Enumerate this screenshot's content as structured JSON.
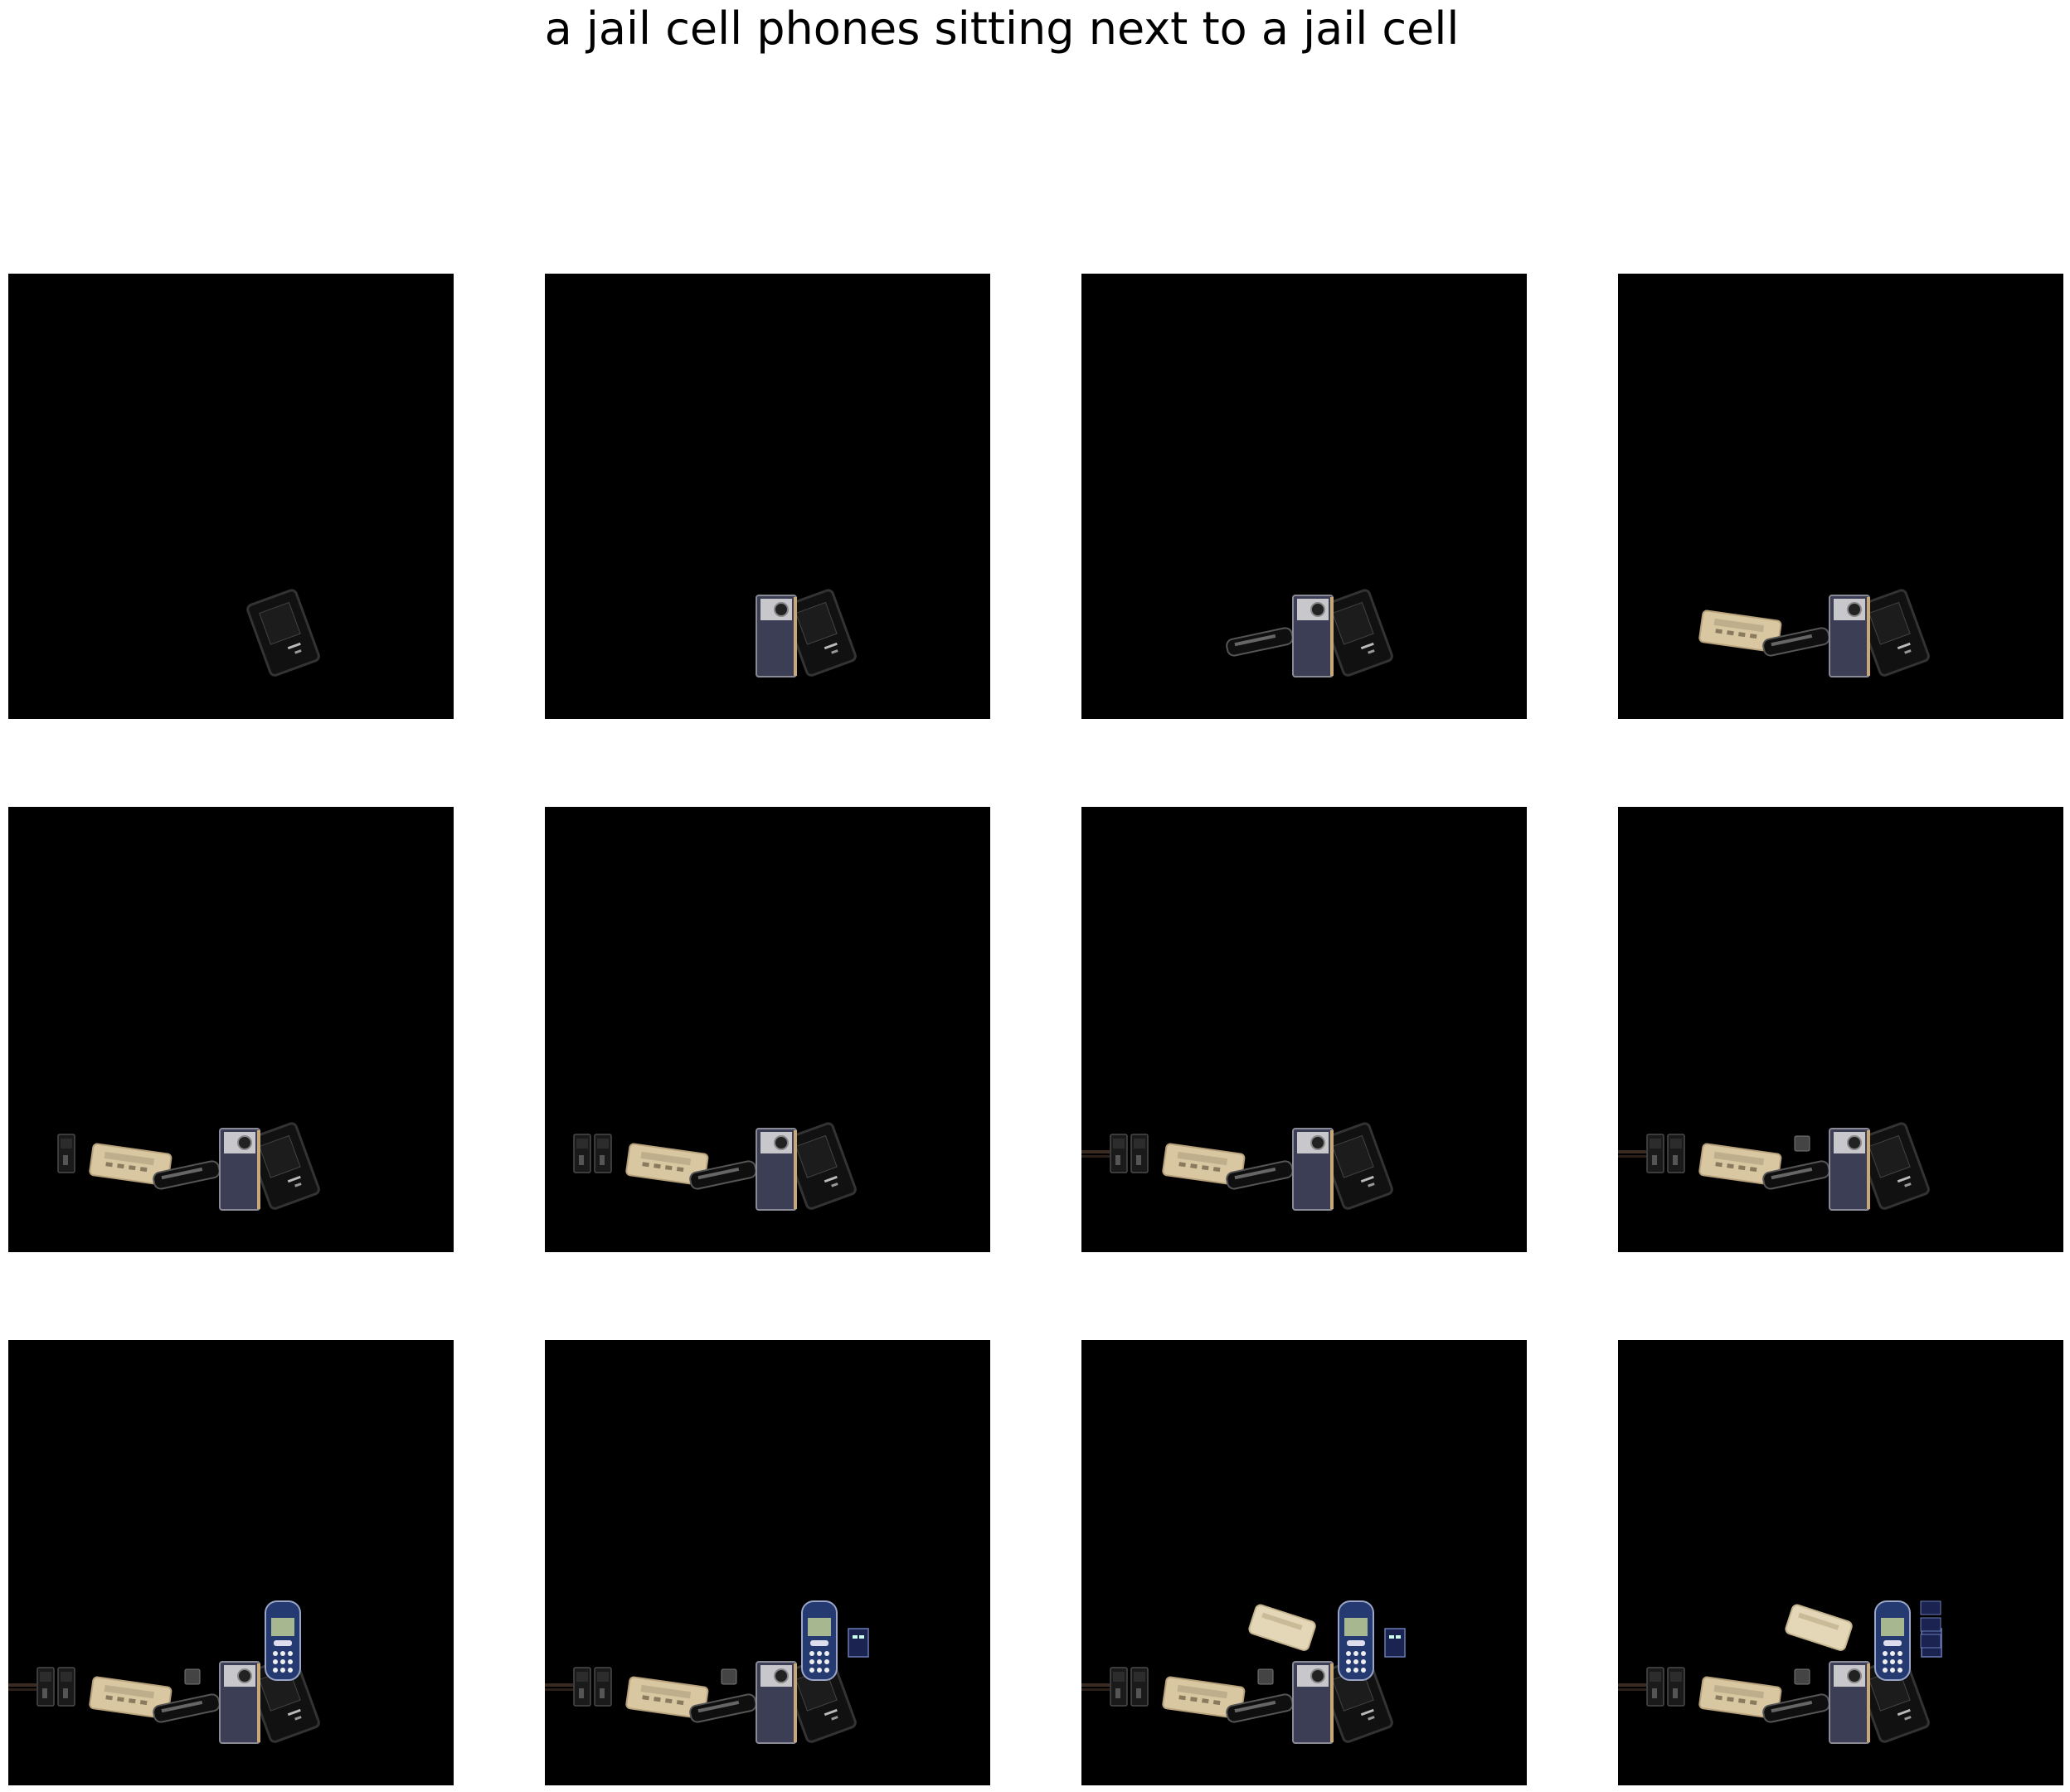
{
  "title": "a jail cell phones sitting next to a jail cell",
  "panels": [
    {
      "id": 1,
      "objects": [
        "black-flip-phone"
      ]
    },
    {
      "id": 2,
      "objects": [
        "black-flip-phone",
        "silver-phone"
      ]
    },
    {
      "id": 3,
      "objects": [
        "black-flip-phone",
        "silver-phone",
        "black-slider-phone"
      ]
    },
    {
      "id": 4,
      "objects": [
        "black-flip-phone",
        "silver-phone",
        "black-slider-phone",
        "beige-brick-phone"
      ]
    },
    {
      "id": 5,
      "objects": [
        "black-flip-phone",
        "silver-phone",
        "black-slider-phone",
        "beige-brick-phone",
        "small-dark-phone"
      ]
    },
    {
      "id": 6,
      "objects": [
        "black-flip-phone",
        "silver-phone",
        "black-slider-phone",
        "beige-brick-phone",
        "small-dark-phone",
        "small-dark-phone-2"
      ]
    },
    {
      "id": 7,
      "objects": [
        "black-flip-phone",
        "silver-phone",
        "black-slider-phone",
        "beige-brick-phone",
        "small-dark-phone",
        "small-dark-phone-2",
        "cable"
      ]
    },
    {
      "id": 8,
      "objects": [
        "black-flip-phone",
        "silver-phone",
        "black-slider-phone",
        "beige-brick-phone",
        "small-dark-phone",
        "small-dark-phone-2",
        "cable",
        "tiny-gray-phone"
      ]
    },
    {
      "id": 9,
      "objects": [
        "black-flip-phone",
        "silver-phone",
        "black-slider-phone",
        "beige-brick-phone",
        "small-dark-phone",
        "small-dark-phone-2",
        "cable",
        "tiny-gray-phone",
        "blue-nokia-phone"
      ]
    },
    {
      "id": 10,
      "objects": [
        "black-flip-phone",
        "silver-phone",
        "black-slider-phone",
        "beige-brick-phone",
        "small-dark-phone",
        "small-dark-phone-2",
        "cable",
        "tiny-gray-phone",
        "blue-nokia-phone",
        "blue-small-screen"
      ]
    },
    {
      "id": 11,
      "objects": [
        "black-flip-phone",
        "silver-phone",
        "black-slider-phone",
        "beige-brick-phone",
        "small-dark-phone",
        "small-dark-phone-2",
        "cable",
        "tiny-gray-phone",
        "blue-nokia-phone",
        "blue-small-screen",
        "beige-phone-tilted"
      ]
    },
    {
      "id": 12,
      "objects": [
        "black-flip-phone",
        "silver-phone",
        "black-slider-phone",
        "beige-brick-phone",
        "small-dark-phone",
        "small-dark-phone-2",
        "cable",
        "tiny-gray-phone",
        "blue-nokia-phone",
        "blue-small-screen",
        "beige-phone-tilted",
        "blue-stacked-screens"
      ]
    }
  ]
}
